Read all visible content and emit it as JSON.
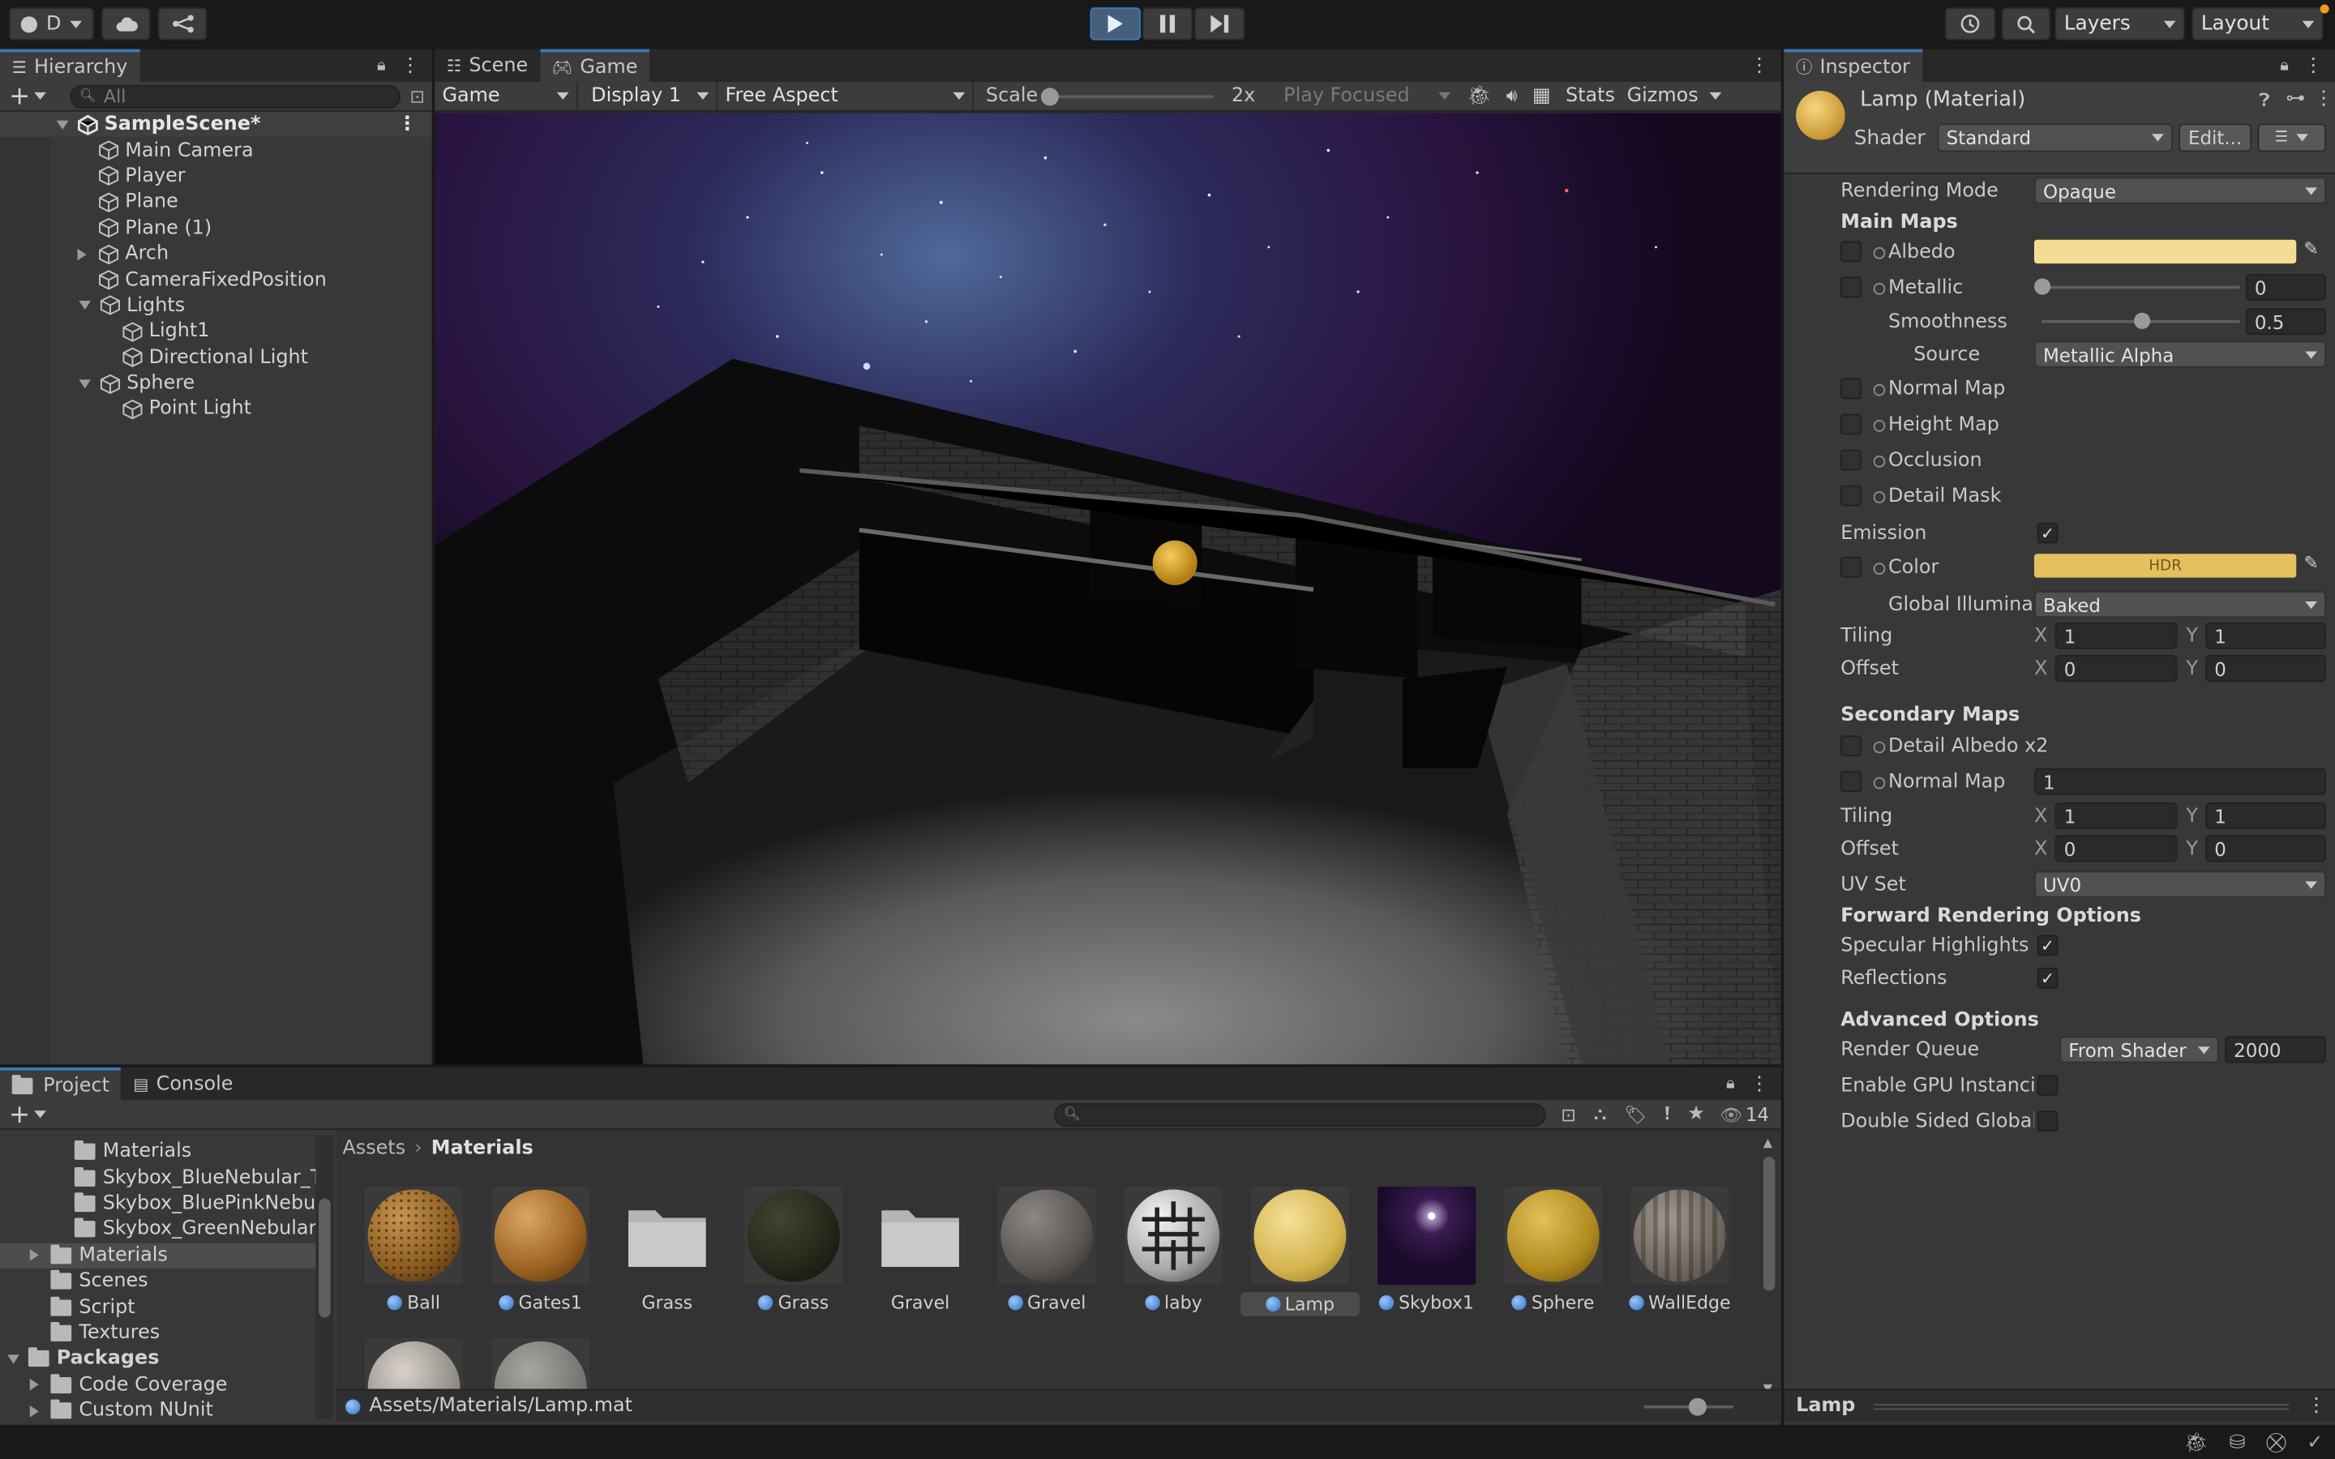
{
  "toolbar": {
    "account_label": "D",
    "layers_label": "Layers",
    "layout_label": "Layout"
  },
  "hierarchy": {
    "tab_label": "Hierarchy",
    "search_placeholder": "All",
    "scene_name": "SampleScene*",
    "items": [
      {
        "label": "Main Camera"
      },
      {
        "label": "Player"
      },
      {
        "label": "Plane"
      },
      {
        "label": "Plane (1)"
      },
      {
        "label": "Arch"
      },
      {
        "label": "CameraFixedPosition"
      },
      {
        "label": "Lights"
      },
      {
        "label": "Light1"
      },
      {
        "label": "Directional Light"
      },
      {
        "label": "Sphere"
      },
      {
        "label": "Point Light"
      }
    ]
  },
  "game_view": {
    "tabs": [
      {
        "label": "Scene"
      },
      {
        "label": "Game"
      }
    ],
    "mode_label": "Game",
    "display_label": "Display 1",
    "aspect_label": "Free Aspect",
    "scale_label": "Scale",
    "scale_value": "2x",
    "scale_fraction": 0.0,
    "play_mode_label": "Play Focused",
    "stats_label": "Stats",
    "gizmos_label": "Gizmos"
  },
  "inspector": {
    "tab_label": "Inspector",
    "material_name": "Lamp (Material)",
    "shader_label": "Shader",
    "shader_value": "Standard",
    "edit_label": "Edit...",
    "rendering_mode_label": "Rendering Mode",
    "rendering_mode_value": "Opaque",
    "main_maps_header": "Main Maps",
    "albedo_label": "Albedo",
    "albedo_color": "#f4dd93",
    "metallic_label": "Metallic",
    "metallic_value": "0",
    "metallic_fraction": 0.0,
    "smoothness_label": "Smoothness",
    "smoothness_value": "0.5",
    "smoothness_fraction": 0.5,
    "source_label": "Source",
    "source_value": "Metallic Alpha",
    "normal_map_label": "Normal Map",
    "height_map_label": "Height Map",
    "occlusion_label": "Occlusion",
    "detail_mask_label": "Detail Mask",
    "emission_label": "Emission",
    "emission_checked": true,
    "color_label": "Color",
    "emission_color": "#e4c15e",
    "hdr_label": "HDR",
    "gi_label": "Global Illuminati",
    "gi_value": "Baked",
    "tiling_label": "Tiling",
    "offset_label": "Offset",
    "x_label": "X",
    "y_label": "Y",
    "main_tiling_x": "1",
    "main_tiling_y": "1",
    "main_offset_x": "0",
    "main_offset_y": "0",
    "secondary_maps_header": "Secondary Maps",
    "detail_albedo_label": "Detail Albedo x2",
    "secondary_normal_label": "Normal Map",
    "secondary_normal_value": "1",
    "sec_tiling_x": "1",
    "sec_tiling_y": "1",
    "sec_offset_x": "0",
    "sec_offset_y": "0",
    "uv_set_label": "UV Set",
    "uv_set_value": "UV0",
    "forward_header": "Forward Rendering Options",
    "specular_label": "Specular Highlights",
    "reflections_label": "Reflections",
    "advanced_header": "Advanced Options",
    "render_queue_label": "Render Queue",
    "render_queue_mode": "From Shader",
    "render_queue_value": "2000",
    "gpu_instancing_label": "Enable GPU Instancir",
    "double_sided_label": "Double Sided Global I",
    "preview_label": "Lamp"
  },
  "project": {
    "tabs": [
      {
        "label": "Project"
      },
      {
        "label": "Console"
      }
    ],
    "hidden_count": "14",
    "tree": [
      {
        "label": "Materials"
      },
      {
        "label": "Skybox_BlueNebular_Te"
      },
      {
        "label": "Skybox_BluePinkNebul"
      },
      {
        "label": "Skybox_GreenNebular_"
      },
      {
        "label": "Materials"
      },
      {
        "label": "Scenes"
      },
      {
        "label": "Script"
      },
      {
        "label": "Textures"
      },
      {
        "label": "Packages"
      },
      {
        "label": "Code Coverage"
      },
      {
        "label": "Custom NUnit"
      }
    ],
    "breadcrumb": [
      "Assets",
      "Materials"
    ],
    "assets": [
      {
        "label": "Ball",
        "kind": "material",
        "icon": "ball-thumbnail"
      },
      {
        "label": "Gates1",
        "kind": "material",
        "icon": "gates-thumbnail"
      },
      {
        "label": "Grass",
        "kind": "folder",
        "icon": "folder-icon"
      },
      {
        "label": "Grass",
        "kind": "material",
        "icon": "grass-thumbnail"
      },
      {
        "label": "Gravel",
        "kind": "folder",
        "icon": "folder-icon"
      },
      {
        "label": "Gravel",
        "kind": "material",
        "icon": "gravel-thumbnail"
      },
      {
        "label": "laby",
        "kind": "material",
        "icon": "laby-thumbnail"
      },
      {
        "label": "Lamp",
        "kind": "material",
        "icon": "lamp-thumbnail"
      },
      {
        "label": "Skybox1",
        "kind": "material",
        "icon": "skybox-thumbnail"
      },
      {
        "label": "Sphere",
        "kind": "material",
        "icon": "sphere-thumbnail"
      },
      {
        "label": "WallEdge",
        "kind": "material",
        "icon": "walledge-thumbnail"
      }
    ],
    "status_path": "Assets/Materials/Lamp.mat",
    "thumb_size_fraction": 0.6
  }
}
